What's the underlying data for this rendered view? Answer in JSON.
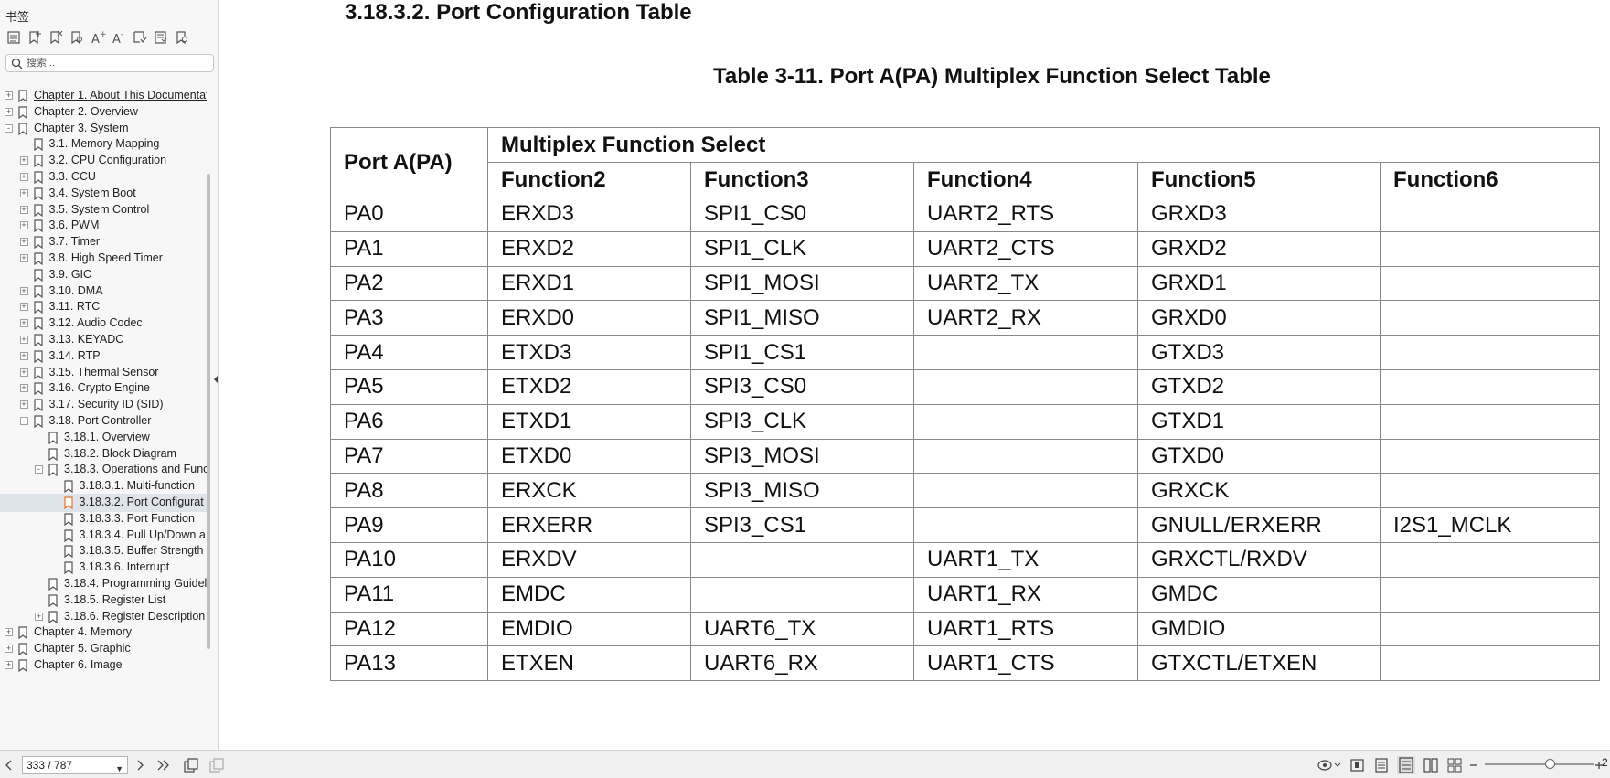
{
  "sidebar": {
    "title": "书签",
    "search_placeholder": "搜索...",
    "items": [
      {
        "label": "Chapter 1. About This Documentat",
        "level": 0,
        "exp": "+"
      },
      {
        "label": "Chapter 2. Overview",
        "level": 0,
        "exp": "+"
      },
      {
        "label": "Chapter 3. System",
        "level": 0,
        "exp": "-"
      },
      {
        "label": "3.1. Memory Mapping",
        "level": 1,
        "exp": ""
      },
      {
        "label": "3.2. CPU Configuration",
        "level": 1,
        "exp": "+"
      },
      {
        "label": "3.3. CCU",
        "level": 1,
        "exp": "+"
      },
      {
        "label": "3.4. System Boot",
        "level": 1,
        "exp": "+"
      },
      {
        "label": "3.5. System Control",
        "level": 1,
        "exp": "+"
      },
      {
        "label": "3.6. PWM",
        "level": 1,
        "exp": "+"
      },
      {
        "label": "3.7. Timer",
        "level": 1,
        "exp": "+"
      },
      {
        "label": "3.8. High Speed Timer",
        "level": 1,
        "exp": "+"
      },
      {
        "label": "3.9. GIC",
        "level": 1,
        "exp": ""
      },
      {
        "label": "3.10. DMA",
        "level": 1,
        "exp": "+"
      },
      {
        "label": "3.11. RTC",
        "level": 1,
        "exp": "+"
      },
      {
        "label": "3.12. Audio Codec",
        "level": 1,
        "exp": "+"
      },
      {
        "label": "3.13. KEYADC",
        "level": 1,
        "exp": "+"
      },
      {
        "label": "3.14. RTP",
        "level": 1,
        "exp": "+"
      },
      {
        "label": "3.15. Thermal Sensor",
        "level": 1,
        "exp": "+"
      },
      {
        "label": "3.16. Crypto Engine",
        "level": 1,
        "exp": "+"
      },
      {
        "label": "3.17. Security ID (SID)",
        "level": 1,
        "exp": "+"
      },
      {
        "label": "3.18. Port Controller",
        "level": 1,
        "exp": "-"
      },
      {
        "label": "3.18.1. Overview",
        "level": 2,
        "exp": ""
      },
      {
        "label": "3.18.2. Block Diagram",
        "level": 2,
        "exp": ""
      },
      {
        "label": "3.18.3. Operations and Func",
        "level": 2,
        "exp": "-"
      },
      {
        "label": "3.18.3.1. Multi-function",
        "level": 3,
        "exp": ""
      },
      {
        "label": "3.18.3.2. Port Configurat",
        "level": 3,
        "exp": ""
      },
      {
        "label": "3.18.3.3. Port Function",
        "level": 3,
        "exp": ""
      },
      {
        "label": "3.18.3.4. Pull Up/Down a",
        "level": 3,
        "exp": ""
      },
      {
        "label": "3.18.3.5. Buffer Strength",
        "level": 3,
        "exp": ""
      },
      {
        "label": "3.18.3.6. Interrupt",
        "level": 3,
        "exp": ""
      },
      {
        "label": "3.18.4. Programming Guidel",
        "level": 2,
        "exp": ""
      },
      {
        "label": "3.18.5. Register List",
        "level": 2,
        "exp": ""
      },
      {
        "label": "3.18.6. Register Description",
        "level": 2,
        "exp": "+"
      },
      {
        "label": "Chapter 4. Memory",
        "level": 0,
        "exp": "+"
      },
      {
        "label": "Chapter 5. Graphic",
        "level": 0,
        "exp": "+"
      },
      {
        "label": "Chapter 6. Image",
        "level": 0,
        "exp": "+"
      }
    ],
    "selected_index": 25,
    "accent_color": "#e8742a"
  },
  "document": {
    "section_heading": "3.18.3.2. Port Configuration Table",
    "table_caption": "Table 3-11. Port A(PA) Multiplex Function Select Table",
    "table": {
      "port_header": "Port A(PA)",
      "group_header": "Multiplex Function Select",
      "columns": [
        "Function2",
        "Function3",
        "Function4",
        "Function5",
        "Function6"
      ],
      "rows": [
        [
          "PA0",
          "ERXD3",
          "SPI1_CS0",
          "UART2_RTS",
          "GRXD3",
          ""
        ],
        [
          "PA1",
          "ERXD2",
          "SPI1_CLK",
          "UART2_CTS",
          "GRXD2",
          ""
        ],
        [
          "PA2",
          "ERXD1",
          "SPI1_MOSI",
          "UART2_TX",
          "GRXD1",
          ""
        ],
        [
          "PA3",
          "ERXD0",
          "SPI1_MISO",
          "UART2_RX",
          "GRXD0",
          ""
        ],
        [
          "PA4",
          "ETXD3",
          "SPI1_CS1",
          "",
          "GTXD3",
          ""
        ],
        [
          "PA5",
          "ETXD2",
          "SPI3_CS0",
          "",
          "GTXD2",
          ""
        ],
        [
          "PA6",
          "ETXD1",
          "SPI3_CLK",
          "",
          "GTXD1",
          ""
        ],
        [
          "PA7",
          "ETXD0",
          "SPI3_MOSI",
          "",
          "GTXD0",
          ""
        ],
        [
          "PA8",
          "ERXCK",
          "SPI3_MISO",
          "",
          "GRXCK",
          ""
        ],
        [
          "PA9",
          "ERXERR",
          "SPI3_CS1",
          "",
          "GNULL/ERXERR",
          "I2S1_MCLK"
        ],
        [
          "PA10",
          "ERXDV",
          "",
          "UART1_TX",
          "GRXCTL/RXDV",
          ""
        ],
        [
          "PA11",
          "EMDC",
          "",
          "UART1_RX",
          "GMDC",
          ""
        ],
        [
          "PA12",
          "EMDIO",
          "UART6_TX",
          "UART1_RTS",
          "GMDIO",
          ""
        ],
        [
          "PA13",
          "ETXEN",
          "UART6_RX",
          "UART1_CTS",
          "GTXCTL/ETXEN",
          ""
        ]
      ]
    }
  },
  "statusbar": {
    "page_value": "333 / 787",
    "zoom_label": "2"
  }
}
